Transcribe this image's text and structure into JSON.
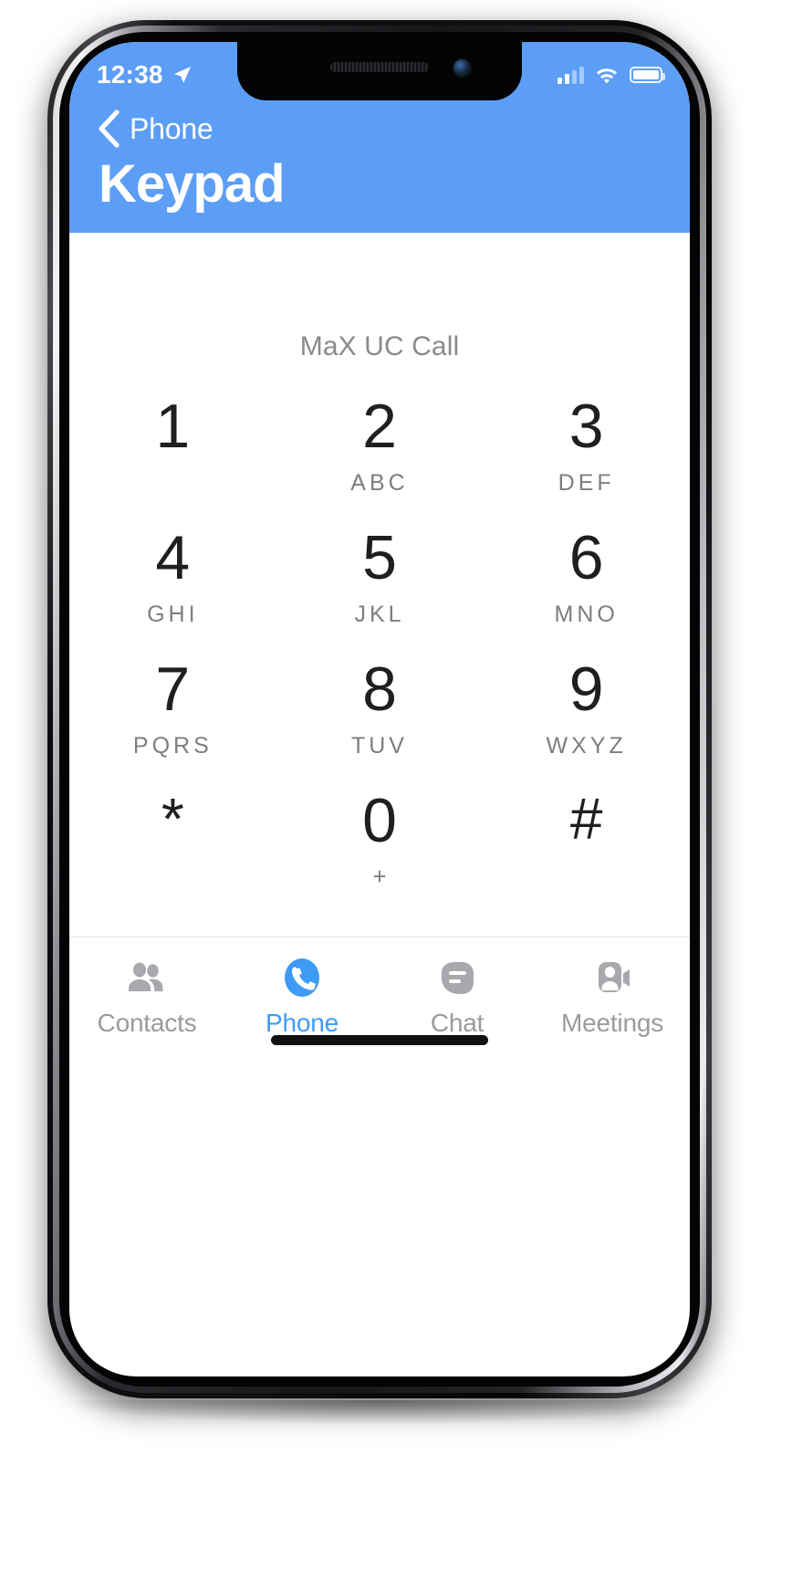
{
  "status_bar": {
    "time": "12:38",
    "location_icon": "location-arrow-icon",
    "signal_icon": "cellular-signal-icon",
    "signal_bars_filled": 2,
    "signal_bars_total": 4,
    "wifi_icon": "wifi-icon",
    "battery_icon": "battery-full-icon"
  },
  "nav": {
    "back_icon": "chevron-left-icon",
    "back_label": "Phone",
    "title": "Keypad",
    "bar_color": "#5c9ef5"
  },
  "main": {
    "call_type_label": "MaX UC Call",
    "keys": [
      {
        "digit": "1",
        "letters": ""
      },
      {
        "digit": "2",
        "letters": "ABC"
      },
      {
        "digit": "3",
        "letters": "DEF"
      },
      {
        "digit": "4",
        "letters": "GHI"
      },
      {
        "digit": "5",
        "letters": "JKL"
      },
      {
        "digit": "6",
        "letters": "MNO"
      },
      {
        "digit": "7",
        "letters": "PQRS"
      },
      {
        "digit": "8",
        "letters": "TUV"
      },
      {
        "digit": "9",
        "letters": "WXYZ"
      },
      {
        "digit": "*",
        "letters": ""
      },
      {
        "digit": "0",
        "letters": "+"
      },
      {
        "digit": "#",
        "letters": ""
      }
    ],
    "call_button": {
      "icon": "phone-handset-icon",
      "color": "#9ad64c"
    }
  },
  "tabbar": {
    "active_color": "#3e9bf5",
    "inactive_color": "#9b9b9f",
    "tabs": [
      {
        "label": "Contacts",
        "icon": "contacts-people-icon",
        "active": false
      },
      {
        "label": "Phone",
        "icon": "phone-handset-icon",
        "active": true
      },
      {
        "label": "Chat",
        "icon": "chat-bubble-icon",
        "active": false
      },
      {
        "label": "Meetings",
        "icon": "meetings-video-person-icon",
        "active": false
      }
    ]
  }
}
